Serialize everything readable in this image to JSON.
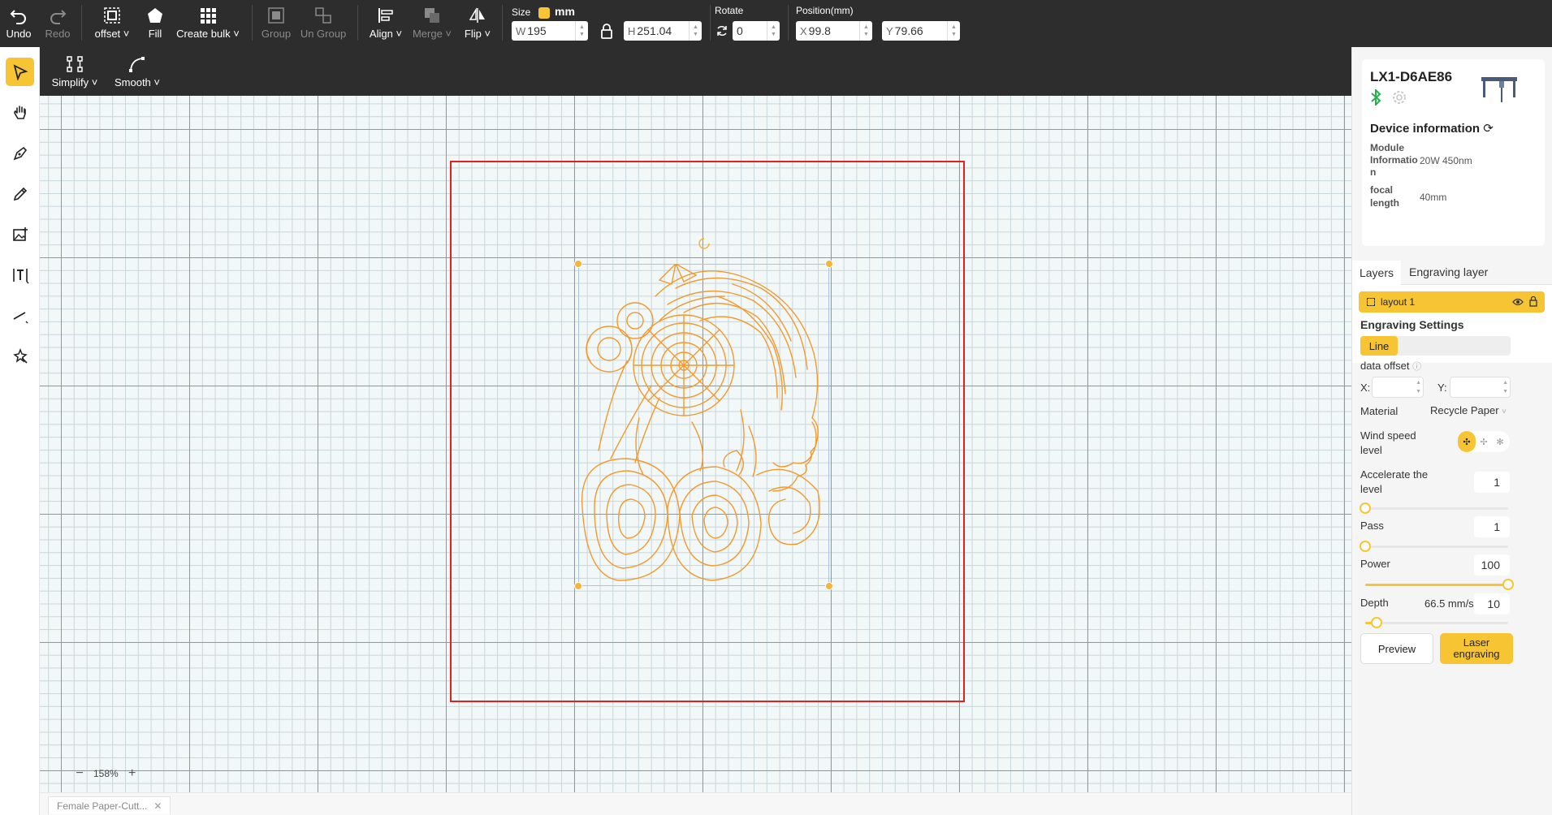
{
  "toolbar": {
    "undo": "Undo",
    "redo": "Redo",
    "offset": "offset",
    "fill": "Fill",
    "create_bulk": "Create bulk",
    "group": "Group",
    "ungroup": "Un Group",
    "align": "Align",
    "merge": "Merge",
    "flip": "Flip",
    "size_label": "Size",
    "unit": "mm",
    "w_prefix": "W",
    "w_value": "195",
    "h_prefix": "H",
    "h_value": "251.04",
    "rotate_label": "Rotate",
    "rotate_value": "0",
    "position_label": "Position(mm)",
    "x_prefix": "X",
    "x_value": "99.8",
    "y_prefix": "Y",
    "y_value": "79.66"
  },
  "subtoolbar": {
    "simplify": "Simplify",
    "smooth": "Smooth"
  },
  "left_tools": [
    "select-icon",
    "hand-icon",
    "pen-icon",
    "pencil-icon",
    "image-add-icon",
    "text-icon",
    "line-icon",
    "magic-icon"
  ],
  "canvas": {
    "zoom": "158%"
  },
  "file_tab": {
    "name": "Female Paper-Cutt..."
  },
  "device": {
    "name": "LX1-D6AE86",
    "info_title": "Device information",
    "module_label": "Module Informatio n",
    "module_value": "20W 450nm",
    "focal_label": "focal length",
    "focal_value": "40mm"
  },
  "layers": {
    "tab_layers": "Layers",
    "tab_engraving": "Engraving layer",
    "layer_name": "layout 1"
  },
  "engraving": {
    "title": "Engraving Settings",
    "mode": "Line",
    "data_offset": "data offset",
    "x_label": "X:",
    "y_label": "Y:",
    "material_label": "Material",
    "material_value": "Recycle Paper",
    "wind_label": "Wind speed level",
    "accel_label": "Accelerate the level",
    "accel_value": "1",
    "accel_level": 0,
    "pass_label": "Pass",
    "pass_value": "1",
    "pass_level": 0,
    "power_label": "Power",
    "power_value": "100",
    "power_level": 1.0,
    "depth_label": "Depth",
    "depth_speed": "66.5 mm/s",
    "depth_value": "10",
    "depth_level": 0.08,
    "preview": "Preview",
    "laser": "Laser engraving"
  },
  "colors": {
    "accent": "#f7c534",
    "toolbar_bg": "#2d2d2d",
    "workarea_border": "#e0211f",
    "art": "#f29a2e",
    "bluetooth": "#22b14c"
  }
}
